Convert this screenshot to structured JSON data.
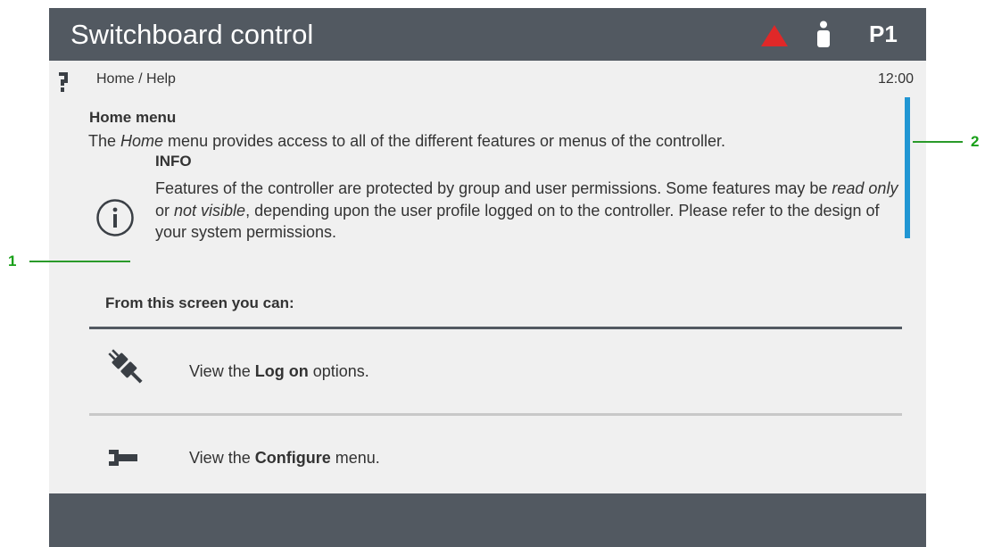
{
  "header": {
    "title": "Switchboard control",
    "profile": "P1",
    "alarm_icon": "alarm-triangle-icon",
    "user_icon": "user-icon"
  },
  "nav": {
    "help_icon": "help-icon",
    "breadcrumb": "Home / Help",
    "clock": "12:00"
  },
  "content": {
    "section_title": "Home menu",
    "intro": {
      "pre": "The ",
      "em": "Home",
      "post": " menu provides access to all of the different features or menus of the controller."
    },
    "info": {
      "icon": "info-icon",
      "title": "INFO",
      "body_1": "Features of the controller are protected by group and user permissions. Some features may be ",
      "em_1": "read only",
      "body_2": " or ",
      "em_2": "not visible",
      "body_3": ", depending upon the user profile logged on to the controller. Please refer to the design of your system permissions."
    },
    "subheading": "From this screen you can:",
    "items": [
      {
        "icon": "plug-icon",
        "pre": "View the ",
        "bold": "Log on",
        "post": " options."
      },
      {
        "icon": "wrench-icon",
        "pre": "View the ",
        "bold": "Configure",
        "post": " menu."
      }
    ]
  },
  "callouts": [
    "1",
    "2"
  ],
  "colors": {
    "bar": "#525961",
    "panel": "#f0f0f0",
    "alarm": "#e02828",
    "scrollbar": "#2196d3",
    "callout": "#19a019"
  }
}
